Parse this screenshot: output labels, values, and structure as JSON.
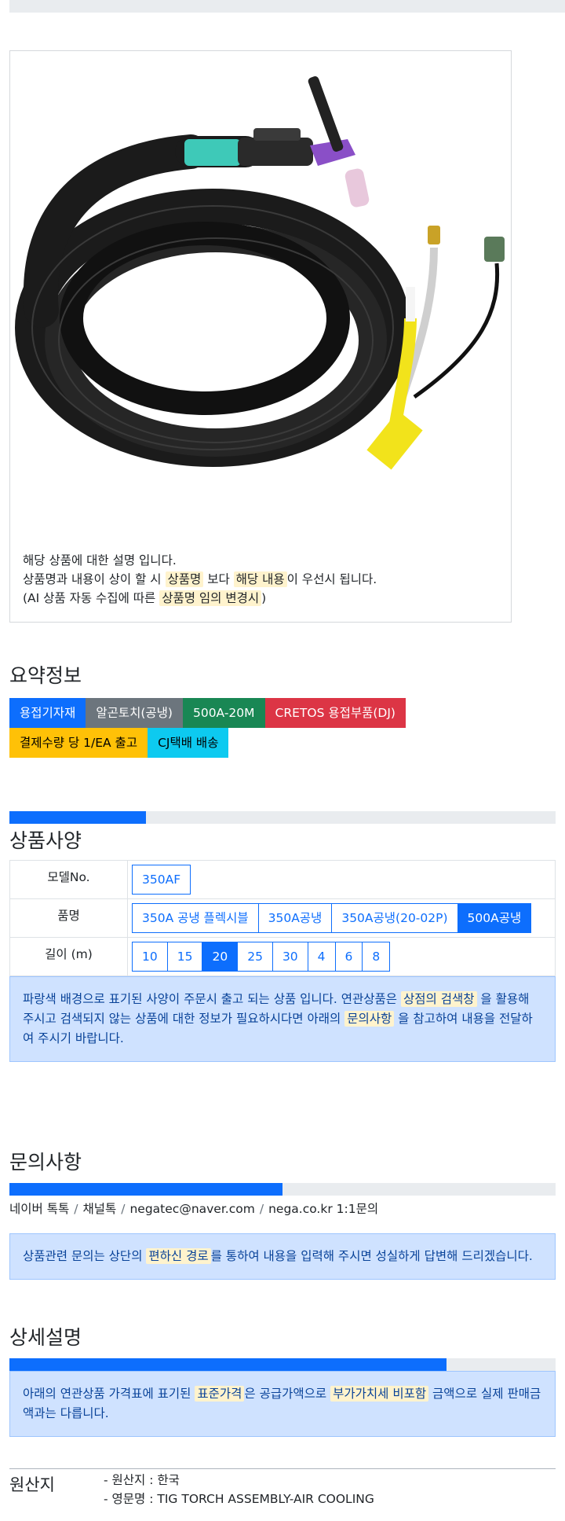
{
  "product": {
    "notice_lines": {
      "l1": "해당 상품에 대한 설명 입니다.",
      "l2_a": "상품명과 내용이 상이 할 시 ",
      "l2_hl1": "상품명",
      "l2_b": " 보다 ",
      "l2_hl2": "해당 내용",
      "l2_c": "이 우선시 됩니다.",
      "l3_a": "(AI 상품 자동 수집에 따른 ",
      "l3_hl": "상품명 임의 변경시",
      "l3_b": ")"
    }
  },
  "summary": {
    "title": "요약정보",
    "badges": [
      "용접기자재",
      "알곤토치(공냉)",
      "500A-20M",
      "CRETOS 용접부품(DJ)",
      "결제수량 당 1/EA 출고",
      "CJ택배 배송"
    ]
  },
  "specs": {
    "progress_percent": 25,
    "title": "상품사양",
    "rows": {
      "model": {
        "label": "모델No.",
        "options": [
          "350AF"
        ],
        "selected": ""
      },
      "name": {
        "label": "품명",
        "options": [
          "350A 공냉 플렉시블",
          "350A공냉",
          "350A공냉(20-02P)",
          "500A공냉"
        ],
        "selected": "500A공냉"
      },
      "length": {
        "label": "길이 (m)",
        "options": [
          "10",
          "15",
          "20",
          "25",
          "30",
          "4",
          "6",
          "8"
        ],
        "selected": "20"
      }
    },
    "note": {
      "a": "파랑색 배경으로 표기된 사양이 주문시 출고 되는 상품 입니다. 연관상품은 ",
      "hl1": "상점의 검색창",
      "b": " 을 활용해 주시고 검색되지 않는 상품에 대한 정보가 필요하시다면 아래의 ",
      "hl2": "문의사항",
      "c": " 을 참고하여 내용을 전달하여 주시기 바랍니다."
    }
  },
  "inquiry": {
    "title": "문의사항",
    "progress_percent": 50,
    "contacts": [
      "네이버 톡톡",
      "채널톡",
      "negatec@naver.com",
      "nega.co.kr 1:1문의"
    ],
    "note": {
      "a": "상품관련 문의는 상단의 ",
      "hl": "편하신 경로",
      "b": "를 통하여 내용을 입력해 주시면 성실하게 답변해 드리겠습니다."
    }
  },
  "detail": {
    "title": "상세설명",
    "progress_percent": 80,
    "note": {
      "a": "아래의 연관상품 가격표에 표기된 ",
      "hl1": "표준가격",
      "b": "은 공급가액으로 ",
      "hl2": "부가가치세 비포함",
      "c": " 금액으로 실제 판매금액과는 다릅니다."
    }
  },
  "origin": {
    "title": "원산지",
    "items": [
      "- 원산지 : 한국",
      "- 영문명 : TIG TORCH ASSEMBLY-AIR COOLING"
    ]
  }
}
